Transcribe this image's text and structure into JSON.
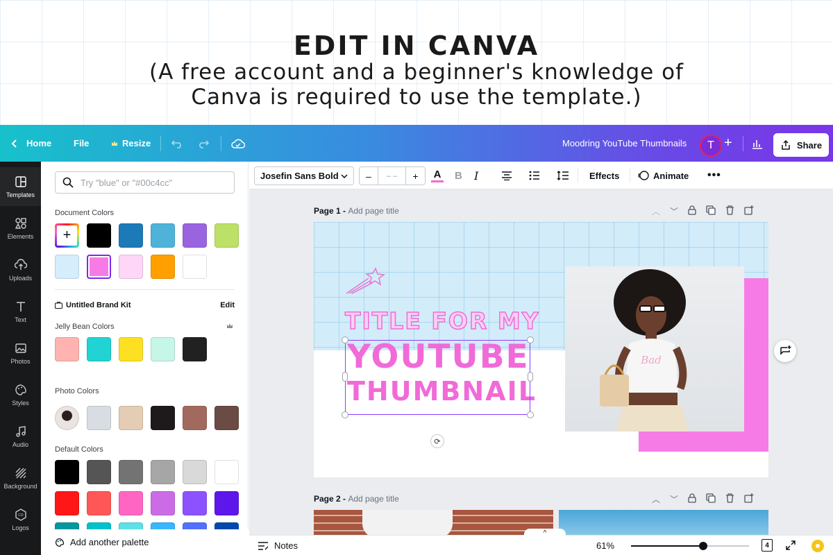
{
  "banner": {
    "title": "EDIT IN CANVA",
    "subtitle_line1": "(A free account and a beginner's knowledge of",
    "subtitle_line2": "Canva is required to use the template.)"
  },
  "appbar": {
    "home_label": "Home",
    "file_label": "File",
    "resize_label": "Resize",
    "doc_title": "Moodring YouTube Thumbnails",
    "avatar_initial": "T",
    "share_label": "Share",
    "gradient_colors": [
      "#17c1cb",
      "#3a8ae0",
      "#6a48e6",
      "#7a35e8"
    ]
  },
  "rail": {
    "items": [
      {
        "label": "Templates",
        "icon": "templates-icon",
        "active": true
      },
      {
        "label": "Elements",
        "icon": "elements-icon",
        "active": false
      },
      {
        "label": "Uploads",
        "icon": "uploads-icon",
        "active": false
      },
      {
        "label": "Text",
        "icon": "text-icon",
        "active": false
      },
      {
        "label": "Photos",
        "icon": "photos-icon",
        "active": false
      },
      {
        "label": "Styles",
        "icon": "styles-icon",
        "active": false
      },
      {
        "label": "Audio",
        "icon": "audio-icon",
        "active": false
      },
      {
        "label": "Background",
        "icon": "background-icon",
        "active": false
      },
      {
        "label": "Logos",
        "icon": "logos-icon",
        "active": false
      }
    ]
  },
  "panel": {
    "search_placeholder": "Try \"blue\" or \"#00c4cc\"",
    "document_colors_label": "Document Colors",
    "document_colors": [
      "#000000",
      "#1d7ab9",
      "#4fb3d9",
      "#9a64e0",
      "#bde066",
      "#d6eefc",
      "#f77be6",
      "#fdd6f8",
      "#ff9f00",
      "#ffffff"
    ],
    "brand_kit_label": "Untitled Brand Kit",
    "brand_kit_edit": "Edit",
    "jelly_label": "Jelly Bean Colors",
    "jelly_colors": [
      "#ffb3b0",
      "#22d3d3",
      "#fde021",
      "#c6f6e8",
      "#212121"
    ],
    "photo_colors_label": "Photo Colors",
    "photo_colors": [
      "#d8dce3",
      "#e4cdb4",
      "#1e1a1b",
      "#a26a5e",
      "#6a4c44"
    ],
    "default_colors_label": "Default Colors",
    "default_colors_row1": [
      "#000000",
      "#555555",
      "#737373",
      "#a6a6a6",
      "#d9d9d9",
      "#ffffff"
    ],
    "default_colors_row2": [
      "#ff1616",
      "#ff5757",
      "#ff66c4",
      "#cb6ce6",
      "#8c52ff",
      "#5e17eb"
    ],
    "default_colors_row3": [
      "#03989e",
      "#00c2cb",
      "#5ce1e6",
      "#38b6ff",
      "#5271ff",
      "#004aad"
    ],
    "add_palette_label": "Add another palette"
  },
  "toolbar": {
    "font_name": "Josefin Sans Bold",
    "size_minus": "–",
    "size_value": "– –",
    "size_plus": "+",
    "effects_label": "Effects",
    "animate_label": "Animate",
    "text_color": "#f06bd8"
  },
  "page1": {
    "label": "Page 1 - ",
    "title_placeholder": "Add page title",
    "line1": "TITLE FOR MY",
    "line2": "YOUTUBE",
    "line3": "THUMBNAIL"
  },
  "page2": {
    "label": "Page 2 - ",
    "title_placeholder": "Add page title"
  },
  "footer": {
    "notes_label": "Notes",
    "zoom_label": "61%",
    "zoom_fraction": 0.61,
    "page_count": "4"
  }
}
